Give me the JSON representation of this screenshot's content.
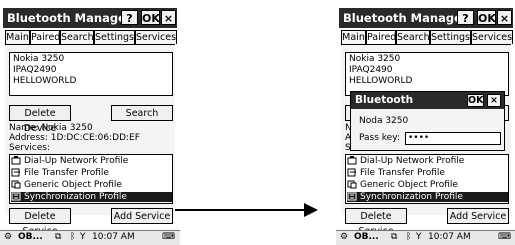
{
  "app": {
    "title": "Bluetooth Manager",
    "help_label": "?",
    "ok_label": "OK",
    "close_label": "×"
  },
  "tabs": [
    {
      "label": "Main"
    },
    {
      "label": "Paired"
    },
    {
      "label": "Search"
    },
    {
      "label": "Settings"
    },
    {
      "label": "Services"
    }
  ],
  "devices": [
    "Nokia 3250",
    "IPAQ2490",
    "HELLOWORLD"
  ],
  "buttons": {
    "delete_device": "Delete Device",
    "search": "Search",
    "delete_service": "Delete Service",
    "add_service": "Add Service"
  },
  "details": {
    "name": "Name: Nokia 3250",
    "address": "Address: 1D:DC:CE:06:DD:EF",
    "services_heading": "Services:"
  },
  "services": [
    {
      "label": "Dial-Up Network Profile",
      "icon": "dialup-icon"
    },
    {
      "label": "File Transfer Profile",
      "icon": "file-transfer-icon"
    },
    {
      "label": "Generic Object Profile",
      "icon": "generic-object-icon"
    },
    {
      "label": "Synchronization Profile",
      "icon": "sync-icon",
      "selected": true
    }
  ],
  "taskbar": {
    "app_label": "OB...",
    "time": "10:07 AM"
  },
  "dialog": {
    "title": "Bluetooth",
    "ok_label": "OK",
    "close_label": "×",
    "device_name": "Noda 3250",
    "pass_key_label": "Pass key:",
    "pass_key_value": "••••"
  },
  "colors": {
    "titlebar": "#2a2a2a",
    "selection": "#1a1a1a",
    "panel": "#f4f4f4"
  }
}
